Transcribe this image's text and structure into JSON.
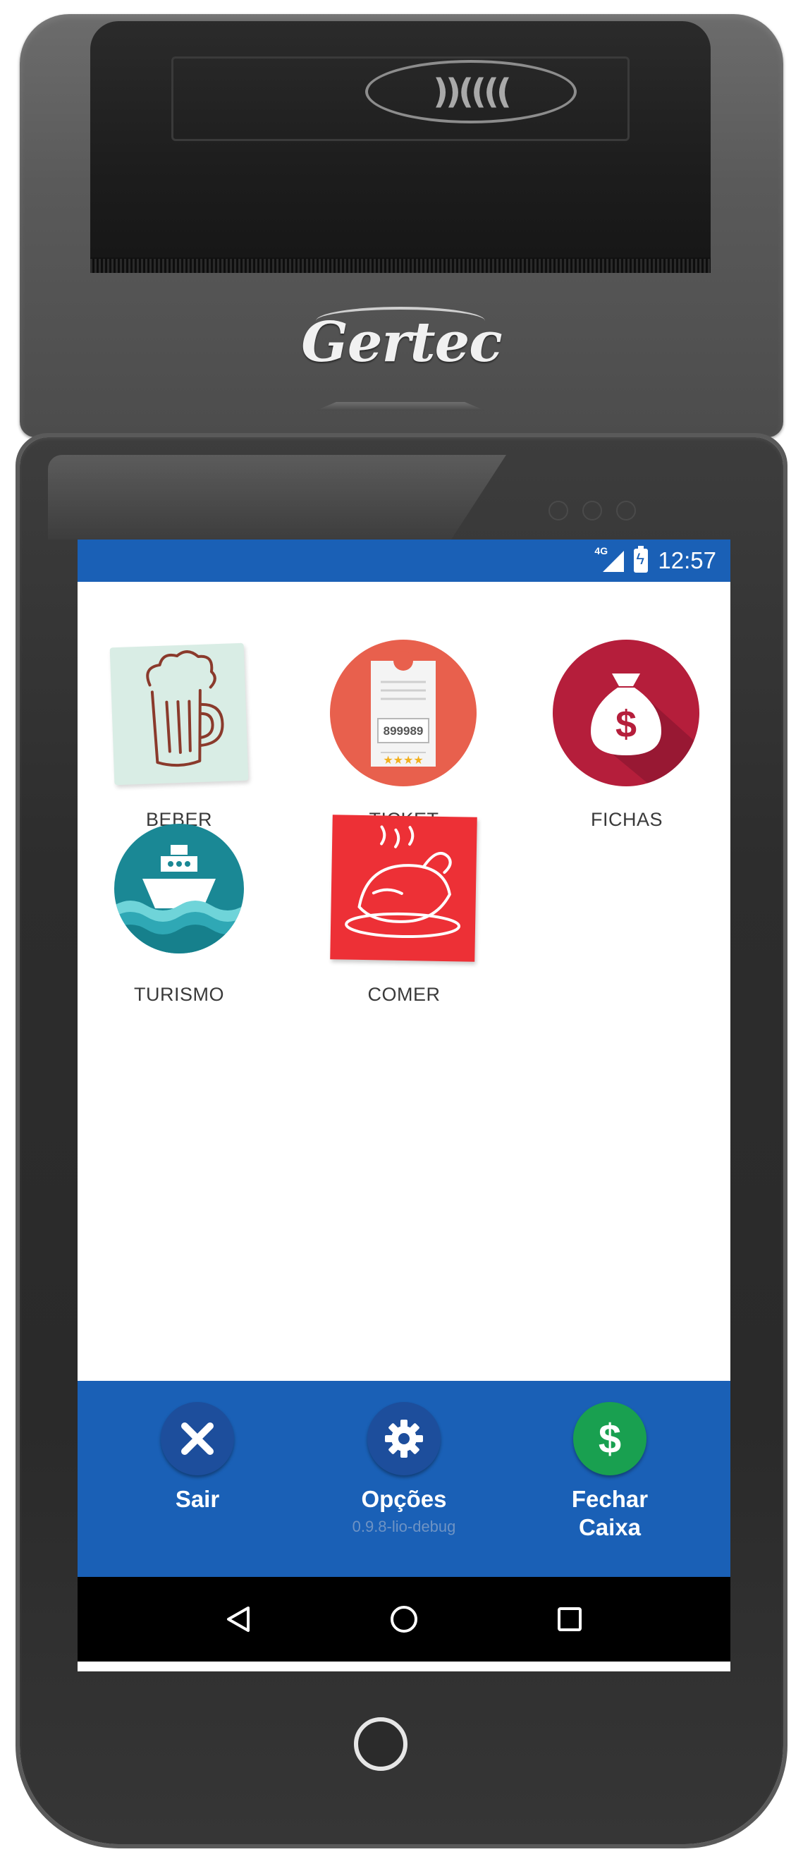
{
  "device": {
    "brand": "Gertec"
  },
  "status_bar": {
    "network": "4G",
    "time": "12:57"
  },
  "apps": [
    {
      "label": "BEBER",
      "icon": "beer-mug-icon"
    },
    {
      "label": "TICKET",
      "icon": "ticket-icon",
      "ticket_number": "899989"
    },
    {
      "label": "FICHAS",
      "icon": "money-bag-icon"
    },
    {
      "label": "TURISMO",
      "icon": "ship-icon"
    },
    {
      "label": "COMER",
      "icon": "roast-chicken-icon"
    }
  ],
  "actions": {
    "exit": {
      "label": "Sair",
      "icon": "close-icon"
    },
    "options": {
      "label": "Opções",
      "icon": "gear-icon",
      "version": "0.9.8-lio-debug"
    },
    "close_register": {
      "label_line1": "Fechar",
      "label_line2": "Caixa",
      "icon": "dollar-icon"
    }
  },
  "nav": {
    "back": "back-icon",
    "home": "home-icon",
    "recents": "recents-icon"
  },
  "colors": {
    "primary_blue": "#1a60b6",
    "exit_button": "#1d4e9c",
    "options_button": "#1d4e9c",
    "close_register_button": "#19a050"
  }
}
